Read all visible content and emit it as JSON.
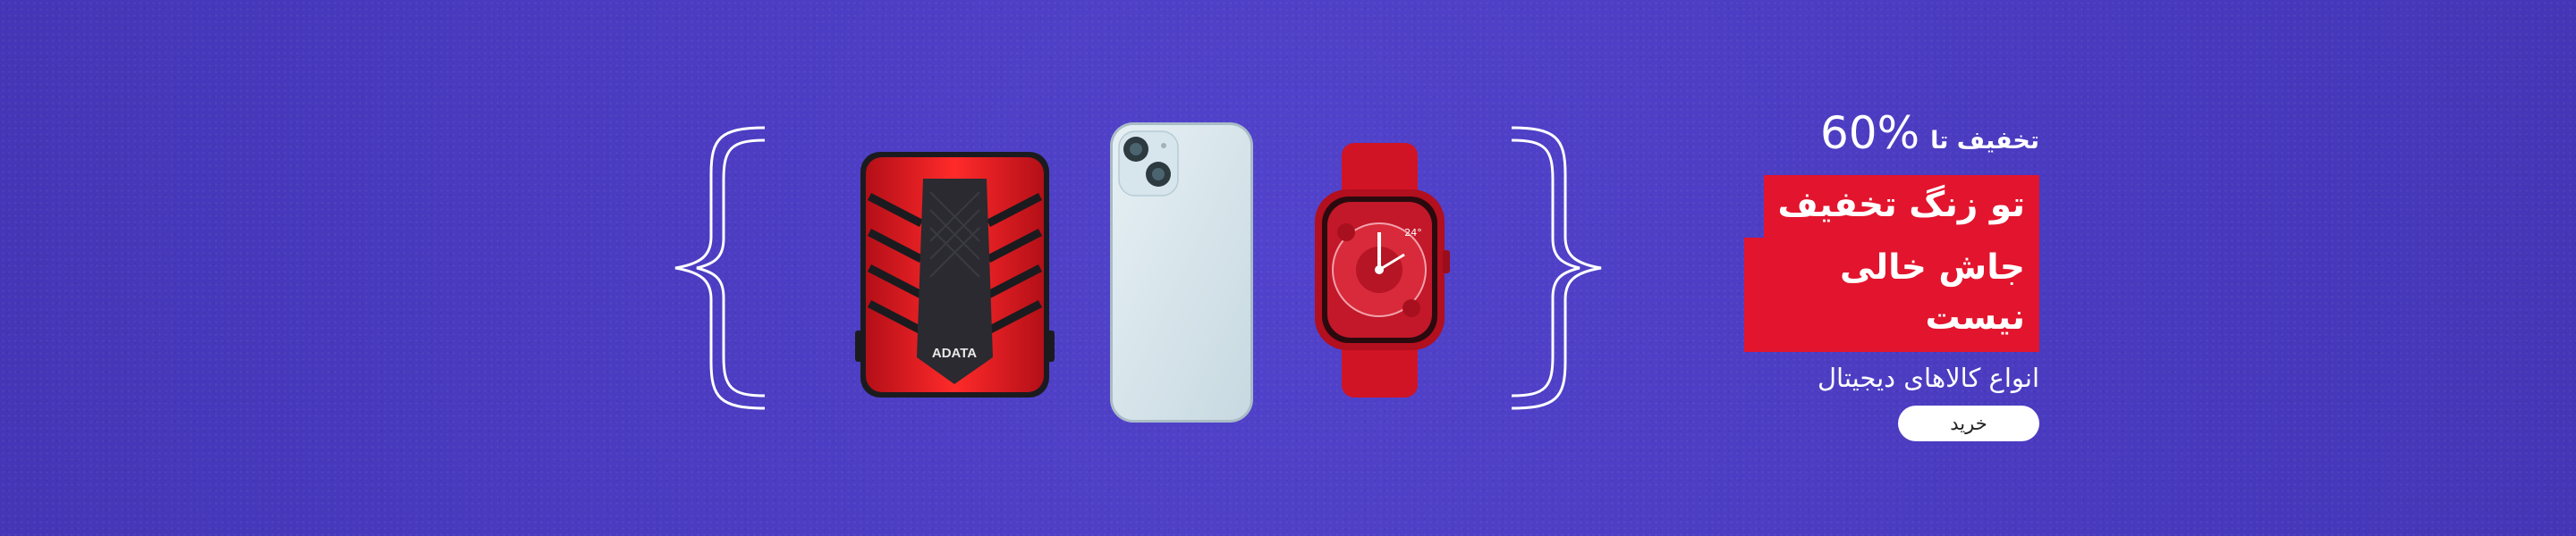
{
  "promo": {
    "discount_prefix": "تخفیف تا",
    "discount_value": "60%",
    "headline_line1": "تو زنگ تخفیف",
    "headline_line2": "جاش خالی نیست",
    "subtitle": "انواع کالاهای دیجیتال",
    "button_label": "خرید"
  },
  "products": {
    "hdd_brand": "ADATA",
    "watch_temp": "24°"
  },
  "colors": {
    "background": "#4a3bc0",
    "accent_red": "#e3142d",
    "text": "#ffffff"
  }
}
